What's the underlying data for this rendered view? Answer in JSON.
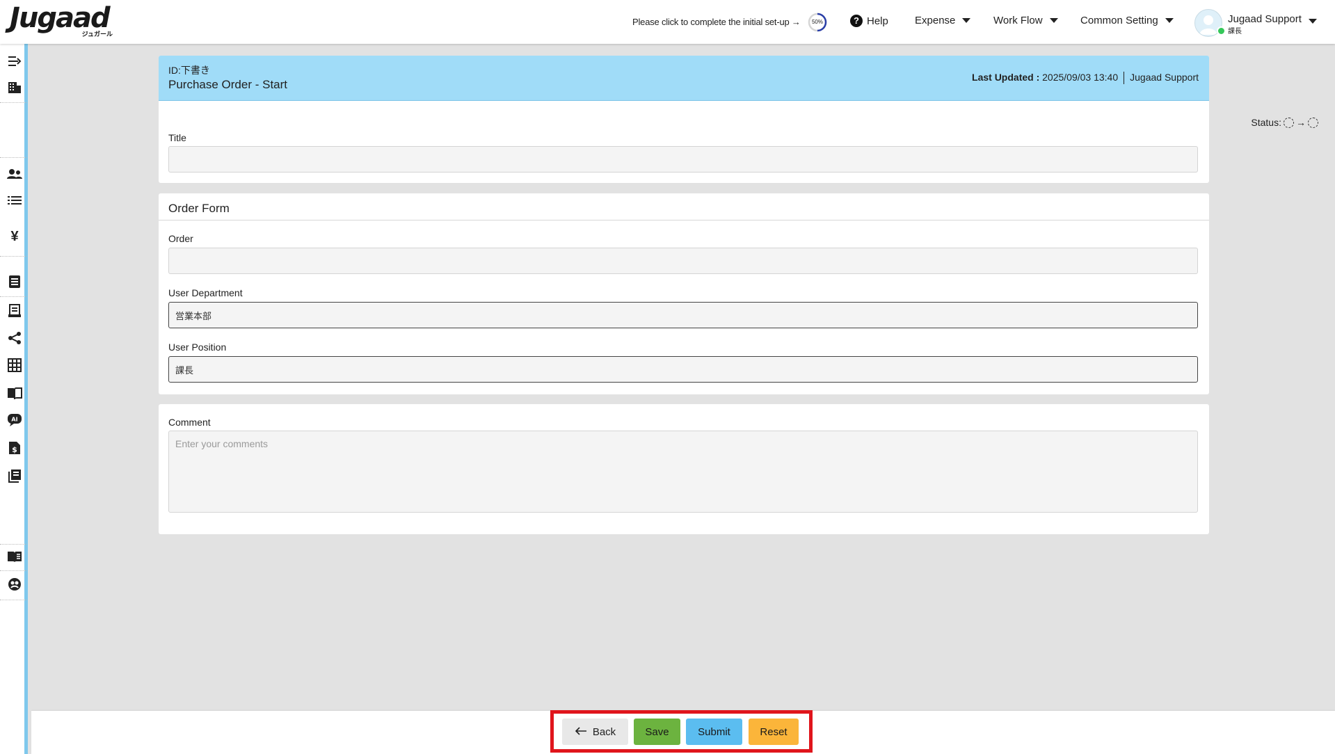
{
  "header": {
    "logo_text": "Jugaad",
    "logo_sub": "ジュガール",
    "setup_message": "Please click to complete the initial set-up →",
    "setup_progress": "50%",
    "help_label": "Help",
    "menus": [
      "Expense",
      "Work Flow",
      "Common Setting"
    ],
    "user_name": "Jugaad Support",
    "user_role": "課長"
  },
  "sidebar": {
    "icons": [
      "menu-expand-icon",
      "building-icon",
      "users-icon",
      "list-icon",
      "yen-icon",
      "document-icon",
      "receipt-icon",
      "share-icon",
      "grid-icon",
      "book-open-icon",
      "ai-chat-icon",
      "invoice-icon",
      "library-icon",
      "manual-icon",
      "support-icon"
    ]
  },
  "form_header": {
    "id_line": "ID:下書き",
    "title": "Purchase Order - Start",
    "last_updated_label": "Last Updated :",
    "last_updated_value": "2025/09/03 13:40",
    "updated_by": "Jugaad Support"
  },
  "status_label": "Status:",
  "title_field": {
    "label": "Title",
    "value": ""
  },
  "order_form": {
    "section_title": "Order Form",
    "order_label": "Order",
    "order_value": "",
    "department_label": "User Department",
    "department_value": "営業本部",
    "position_label": "User Position",
    "position_value": "課長"
  },
  "comment": {
    "label": "Comment",
    "placeholder": "Enter your comments"
  },
  "actions": {
    "back": "Back",
    "save": "Save",
    "submit": "Submit",
    "reset": "Reset"
  },
  "colors": {
    "header_band": "#a0dcf8",
    "sidebar_accent": "#7fc8ec",
    "save": "#6cb33f",
    "submit": "#5bbdf0",
    "reset": "#fbb53a",
    "highlight": "#e0151c"
  }
}
